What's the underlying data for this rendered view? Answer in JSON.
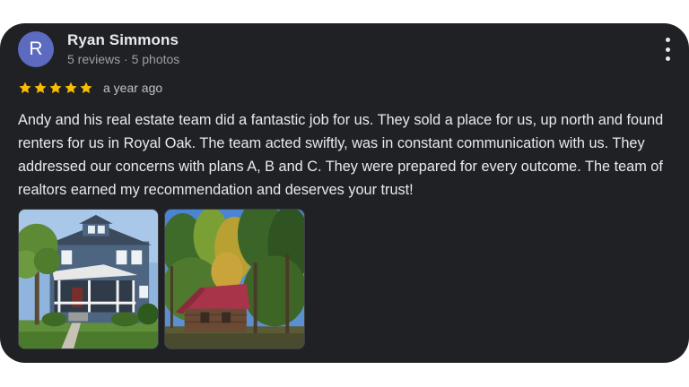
{
  "review": {
    "author": {
      "initial": "R",
      "name": "Ryan Simmons",
      "meta": "5 reviews · 5 photos",
      "avatar_color": "#5c6bc0"
    },
    "rating": 5,
    "star_color": "#fbbc04",
    "date": "a year ago",
    "text": "Andy and his real estate team did a fantastic job for us. They sold a place for us, up north and found renters for us in Royal Oak. The team acted swiftly, was in constant communication with us. They addressed our concerns with plans A, B and C. They were prepared for every outcome. The team of realtors earned my recommendation and deserves your trust!",
    "more_icon": "more-vert-icon",
    "photos": [
      {
        "subject": "blue two-story house with porch"
      },
      {
        "subject": "red-roof cabin in forest"
      }
    ]
  },
  "theme": {
    "card_background": "#202124",
    "text_primary": "#e8eaed",
    "text_secondary": "#9aa0a6"
  }
}
